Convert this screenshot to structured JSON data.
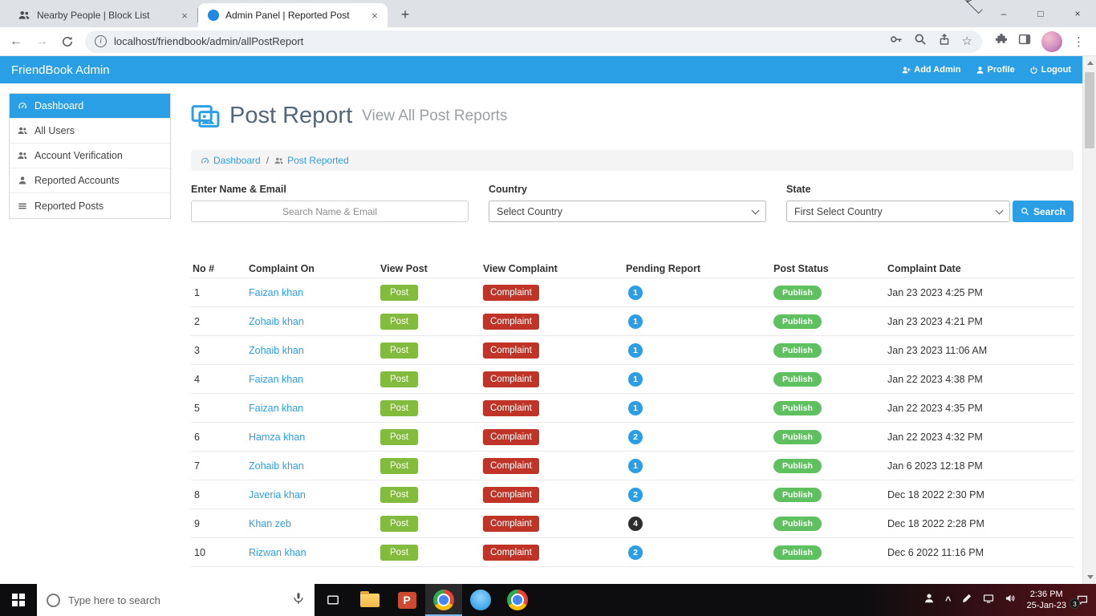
{
  "browser": {
    "tabs": [
      {
        "title": "Nearby People | Block List"
      },
      {
        "title": "Admin Panel | Reported Post"
      }
    ],
    "url": "localhost/friendbook/admin/allPostReport"
  },
  "admin_header": {
    "brand": "FriendBook Admin",
    "add_admin": "Add Admin",
    "profile": "Profile",
    "logout": "Logout"
  },
  "sidebar": {
    "items": [
      {
        "label": "Dashboard"
      },
      {
        "label": "All Users"
      },
      {
        "label": "Account Verification"
      },
      {
        "label": "Reported Accounts"
      },
      {
        "label": "Reported Posts"
      }
    ]
  },
  "page": {
    "title": "Post Report",
    "subtitle": "View All Post Reports",
    "breadcrumb_home": "Dashboard",
    "breadcrumb_separator": "/",
    "breadcrumb_current": "Post Reported"
  },
  "filters": {
    "name_label": "Enter Name & Email",
    "name_placeholder": "Search Name & Email",
    "country_label": "Country",
    "country_value": "Select Country",
    "state_label": "State",
    "state_value": "First Select Country",
    "search_label": "Search"
  },
  "table": {
    "columns": [
      "No #",
      "Complaint On",
      "View Post",
      "View Complaint",
      "Pending Report",
      "Post Status",
      "Complaint Date"
    ],
    "post_label": "Post",
    "complaint_label": "Complaint",
    "publish_label": "Publish",
    "rows": [
      {
        "no": "1",
        "name": "Faizan khan",
        "pending": "1",
        "pending_dark": false,
        "status": "Publish",
        "date": "Jan 23 2023 4:25 PM"
      },
      {
        "no": "2",
        "name": "Zohaib khan",
        "pending": "1",
        "pending_dark": false,
        "status": "Publish",
        "date": "Jan 23 2023 4:21 PM"
      },
      {
        "no": "3",
        "name": "Zohaib khan",
        "pending": "1",
        "pending_dark": false,
        "status": "Publish",
        "date": "Jan 23 2023 11:06 AM"
      },
      {
        "no": "4",
        "name": "Faizan khan",
        "pending": "1",
        "pending_dark": false,
        "status": "Publish",
        "date": "Jan 22 2023 4:38 PM"
      },
      {
        "no": "5",
        "name": "Faizan khan",
        "pending": "1",
        "pending_dark": false,
        "status": "Publish",
        "date": "Jan 22 2023 4:35 PM"
      },
      {
        "no": "6",
        "name": "Hamza khan",
        "pending": "2",
        "pending_dark": false,
        "status": "Publish",
        "date": "Jan 22 2023 4:32 PM"
      },
      {
        "no": "7",
        "name": "Zohaib khan",
        "pending": "1",
        "pending_dark": false,
        "status": "Publish",
        "date": "Jan 6 2023 12:18 PM"
      },
      {
        "no": "8",
        "name": "Javeria khan",
        "pending": "2",
        "pending_dark": false,
        "status": "Publish",
        "date": "Dec 18 2022 2:30 PM"
      },
      {
        "no": "9",
        "name": "Khan zeb",
        "pending": "4",
        "pending_dark": true,
        "status": "Publish",
        "date": "Dec 18 2022 2:28 PM"
      },
      {
        "no": "10",
        "name": "Rizwan khan",
        "pending": "2",
        "pending_dark": false,
        "status": "Publish",
        "date": "Dec 6 2022 11:16 PM"
      }
    ]
  },
  "taskbar": {
    "search_placeholder": "Type here to search",
    "time": "2:36 PM",
    "date": "25-Jan-23",
    "notification_count": "3"
  },
  "icons": {
    "back": "←",
    "forward": "→",
    "tab_close": "×",
    "new_tab": "+",
    "chevron_down": "∨",
    "minimize": "–",
    "maximize": "□",
    "window_close": "×",
    "menu": "⋮",
    "star": "☆",
    "info": "i",
    "caret_up": "^"
  },
  "colors": {
    "accent_blue": "#2b9fe6",
    "green": "#83bb3e",
    "red": "#bf3427",
    "publish_green": "#5fc05f",
    "dark_badge": "#2d2d2d"
  }
}
